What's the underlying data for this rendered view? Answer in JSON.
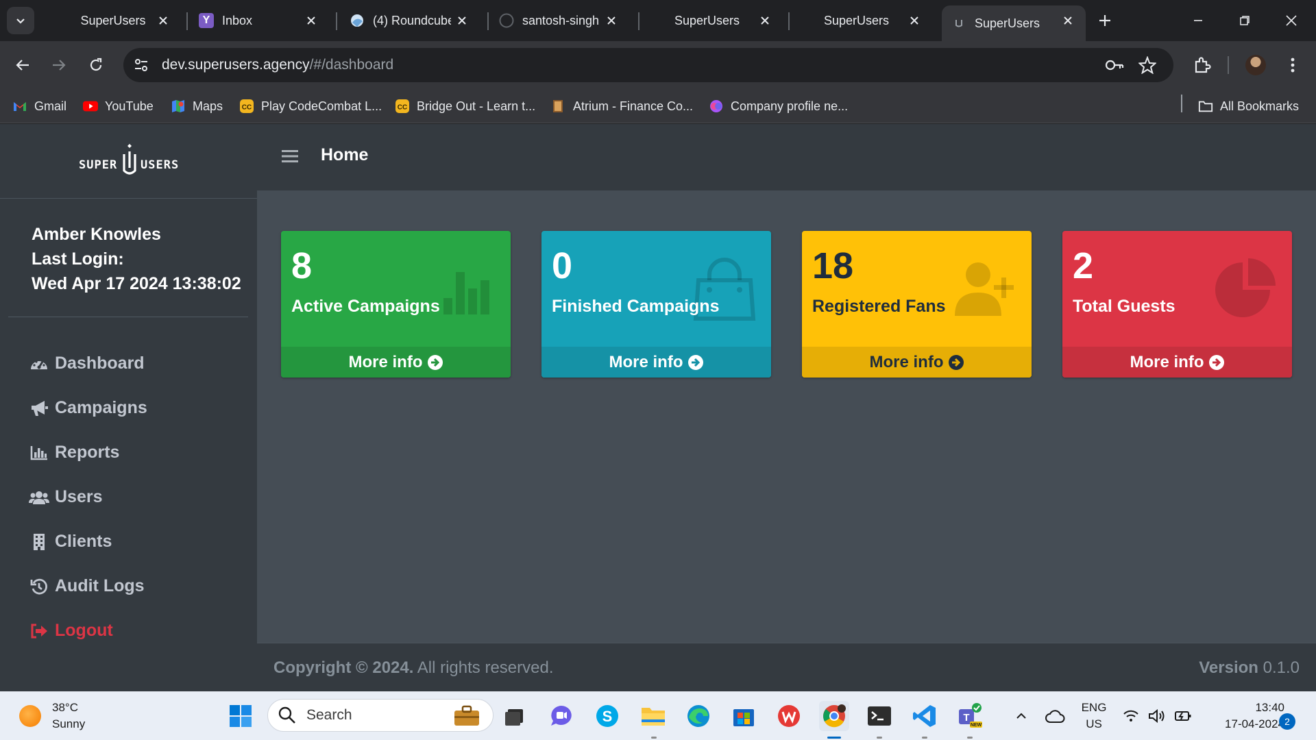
{
  "browser": {
    "tabs": [
      {
        "title": "SuperUsers",
        "icon": "blank-favicon"
      },
      {
        "title": "Inbox",
        "icon": "yahoo-favicon"
      },
      {
        "title": "(4) Roundcube",
        "icon": "roundcube-favicon"
      },
      {
        "title": "santosh-singh",
        "icon": "github-favicon"
      },
      {
        "title": "SuperUsers",
        "icon": "blank-favicon"
      },
      {
        "title": "SuperUsers",
        "icon": "blank-favicon"
      },
      {
        "title": "SuperUsers",
        "icon": "superusers-favicon",
        "active": true
      }
    ],
    "url_host": "dev.superusers.agency",
    "url_path": "/#/dashboard",
    "bookmarks": [
      {
        "label": "Gmail",
        "icon": "gmail-icon"
      },
      {
        "label": "YouTube",
        "icon": "youtube-icon"
      },
      {
        "label": "Maps",
        "icon": "maps-icon"
      },
      {
        "label": "Play CodeCombat L...",
        "icon": "codecombat-icon"
      },
      {
        "label": "Bridge Out - Learn t...",
        "icon": "codecombat-icon"
      },
      {
        "label": "Atrium - Finance Co...",
        "icon": "atrium-icon"
      },
      {
        "label": "Company profile ne...",
        "icon": "company-icon"
      }
    ],
    "all_bookmarks": "All Bookmarks"
  },
  "app": {
    "brand_left": "SUPER",
    "brand_mark": "U",
    "brand_right": "USERS",
    "user_name": "Amber Knowles",
    "last_login_label": "Last Login:",
    "last_login_value": "Wed Apr 17 2024 13:38:02",
    "nav": [
      {
        "label": "Dashboard",
        "icon": "tachometer-icon"
      },
      {
        "label": "Campaigns",
        "icon": "bullhorn-icon"
      },
      {
        "label": "Reports",
        "icon": "bar-chart-icon"
      },
      {
        "label": "Users",
        "icon": "users-icon"
      },
      {
        "label": "Clients",
        "icon": "building-icon"
      },
      {
        "label": "Audit Logs",
        "icon": "history-icon"
      },
      {
        "label": "Logout",
        "icon": "sign-out-icon"
      }
    ],
    "page_title": "Home",
    "cards": [
      {
        "value": "8",
        "label": "Active Campaigns",
        "more": "More info",
        "color": "#28a745",
        "footer_color": "#24963e",
        "icon": "bar-chart-icon"
      },
      {
        "value": "0",
        "label": "Finished Campaigns",
        "more": "More info",
        "color": "#17a2b8",
        "footer_color": "#1592a6",
        "icon": "shopping-bag-icon"
      },
      {
        "value": "18",
        "label": "Registered Fans",
        "more": "More info",
        "color": "#ffc107",
        "footer_color": "#e6ae06",
        "icon": "user-plus-icon"
      },
      {
        "value": "2",
        "label": "Total Guests",
        "more": "More info",
        "color": "#dc3545",
        "footer_color": "#c6303e",
        "icon": "pie-chart-icon"
      }
    ],
    "footer_copyright": "Copyright © 2024.",
    "footer_rights": "All rights reserved.",
    "footer_version_label": "Version",
    "footer_version": "0.1.0"
  },
  "taskbar": {
    "temperature": "38°C",
    "condition": "Sunny",
    "search_placeholder": "Search",
    "lang_top": "ENG",
    "lang_bottom": "US",
    "time": "13:40",
    "date": "17-04-2024",
    "notifications": "2"
  }
}
